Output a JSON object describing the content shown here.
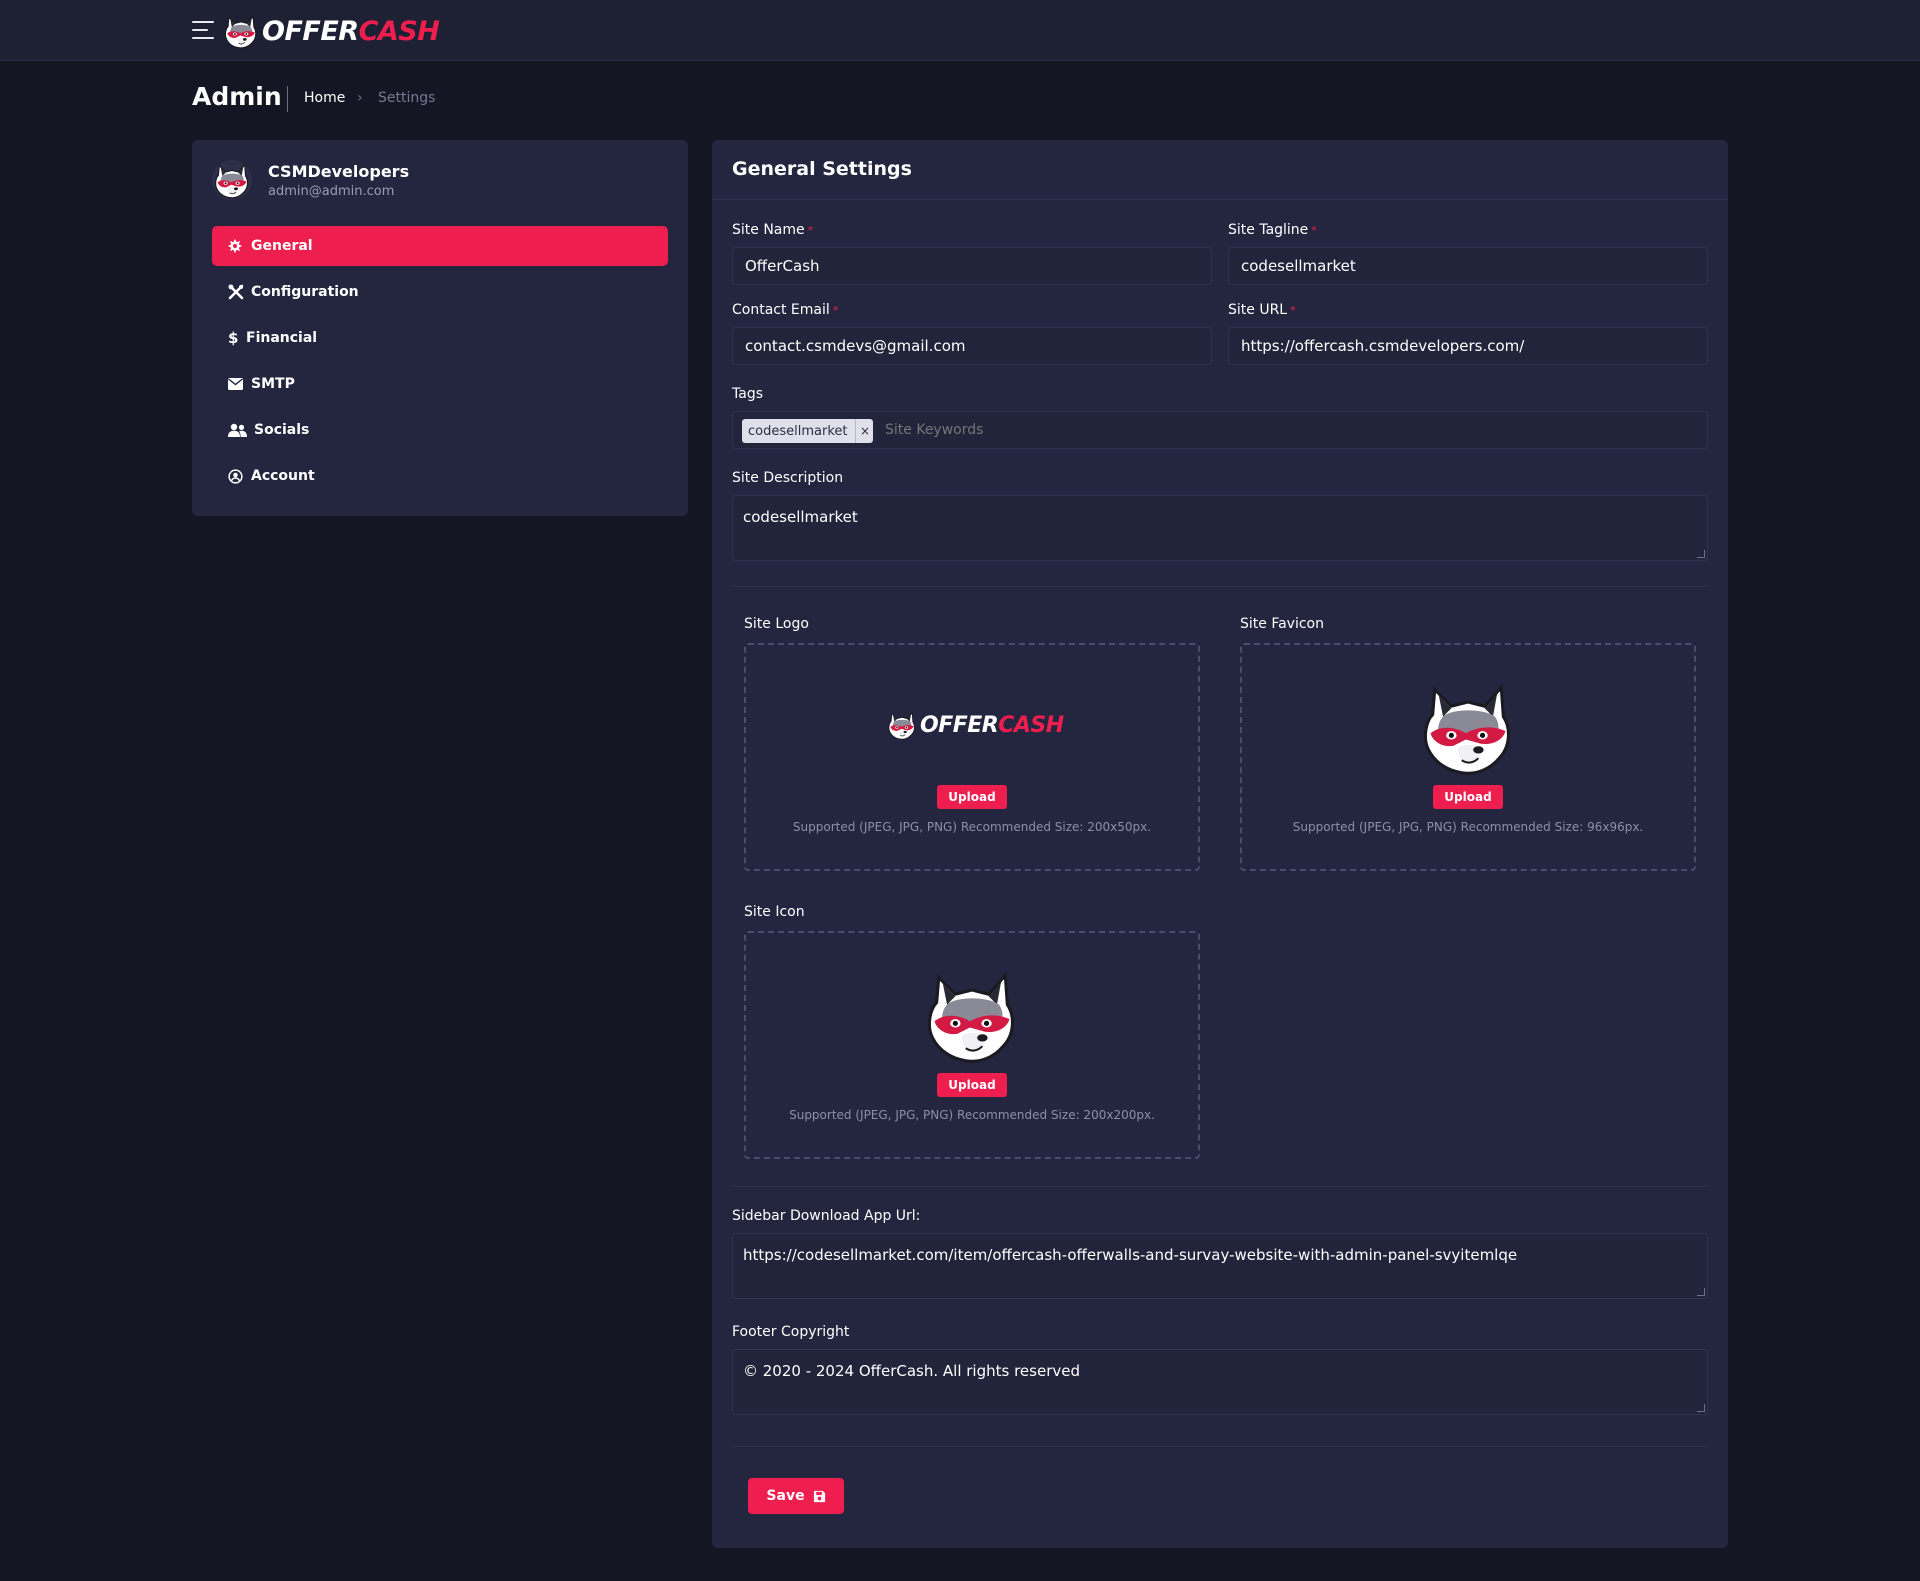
{
  "topbar": {
    "menu_icon": "hamburger-icon",
    "logo_word_1": "OFFER",
    "logo_word_2": "CASH"
  },
  "header": {
    "title": "Admin",
    "breadcrumb": {
      "home": "Home",
      "current": "Settings"
    }
  },
  "user": {
    "name": "CSMDevelopers",
    "email": "admin@admin.com"
  },
  "sidebar": {
    "items": [
      {
        "label": "General",
        "icon": "gear-icon",
        "active": true
      },
      {
        "label": "Configuration",
        "icon": "tools-icon",
        "active": false
      },
      {
        "label": "Financial",
        "icon": "dollar-icon",
        "active": false
      },
      {
        "label": "SMTP",
        "icon": "envelope-icon",
        "active": false
      },
      {
        "label": "Socials",
        "icon": "users-icon",
        "active": false
      },
      {
        "label": "Account",
        "icon": "user-circle-icon",
        "active": false
      }
    ]
  },
  "form": {
    "title": "General Settings",
    "site_name": {
      "label": "Site Name",
      "value": "OfferCash"
    },
    "site_tagline": {
      "label": "Site Tagline",
      "value": "codesellmarket"
    },
    "contact_email": {
      "label": "Contact Email",
      "value": "contact.csmdevs@gmail.com"
    },
    "site_url": {
      "label": "Site URL",
      "value": "https://offercash.csmdevelopers.com/"
    },
    "tags": {
      "label": "Tags",
      "chips": [
        "codesellmarket"
      ],
      "placeholder": "Site Keywords"
    },
    "site_description": {
      "label": "Site Description",
      "value": "codesellmarket"
    },
    "site_logo": {
      "label": "Site Logo",
      "button": "Upload",
      "note": "Supported (JPEG, JPG, PNG) Recommended Size: 200x50px."
    },
    "site_favicon": {
      "label": "Site Favicon",
      "button": "Upload",
      "note": "Supported (JPEG, JPG, PNG) Recommended Size: 96x96px."
    },
    "site_icon": {
      "label": "Site Icon",
      "button": "Upload",
      "note": "Supported (JPEG, JPG, PNG) Recommended Size: 200x200px."
    },
    "sidebar_app_url": {
      "label": "Sidebar Download App Url:",
      "value": "https://codesellmarket.com/item/offercash-offerwalls-and-survay-website-with-admin-panel-svyitemlqe"
    },
    "footer_copyright": {
      "label": "Footer Copyright",
      "value": "© 2020 - 2024 OfferCash. All rights reserved"
    },
    "save_label": "Save"
  },
  "colors": {
    "accent": "#ee1e4e",
    "background": "#141624",
    "card": "#242640"
  }
}
